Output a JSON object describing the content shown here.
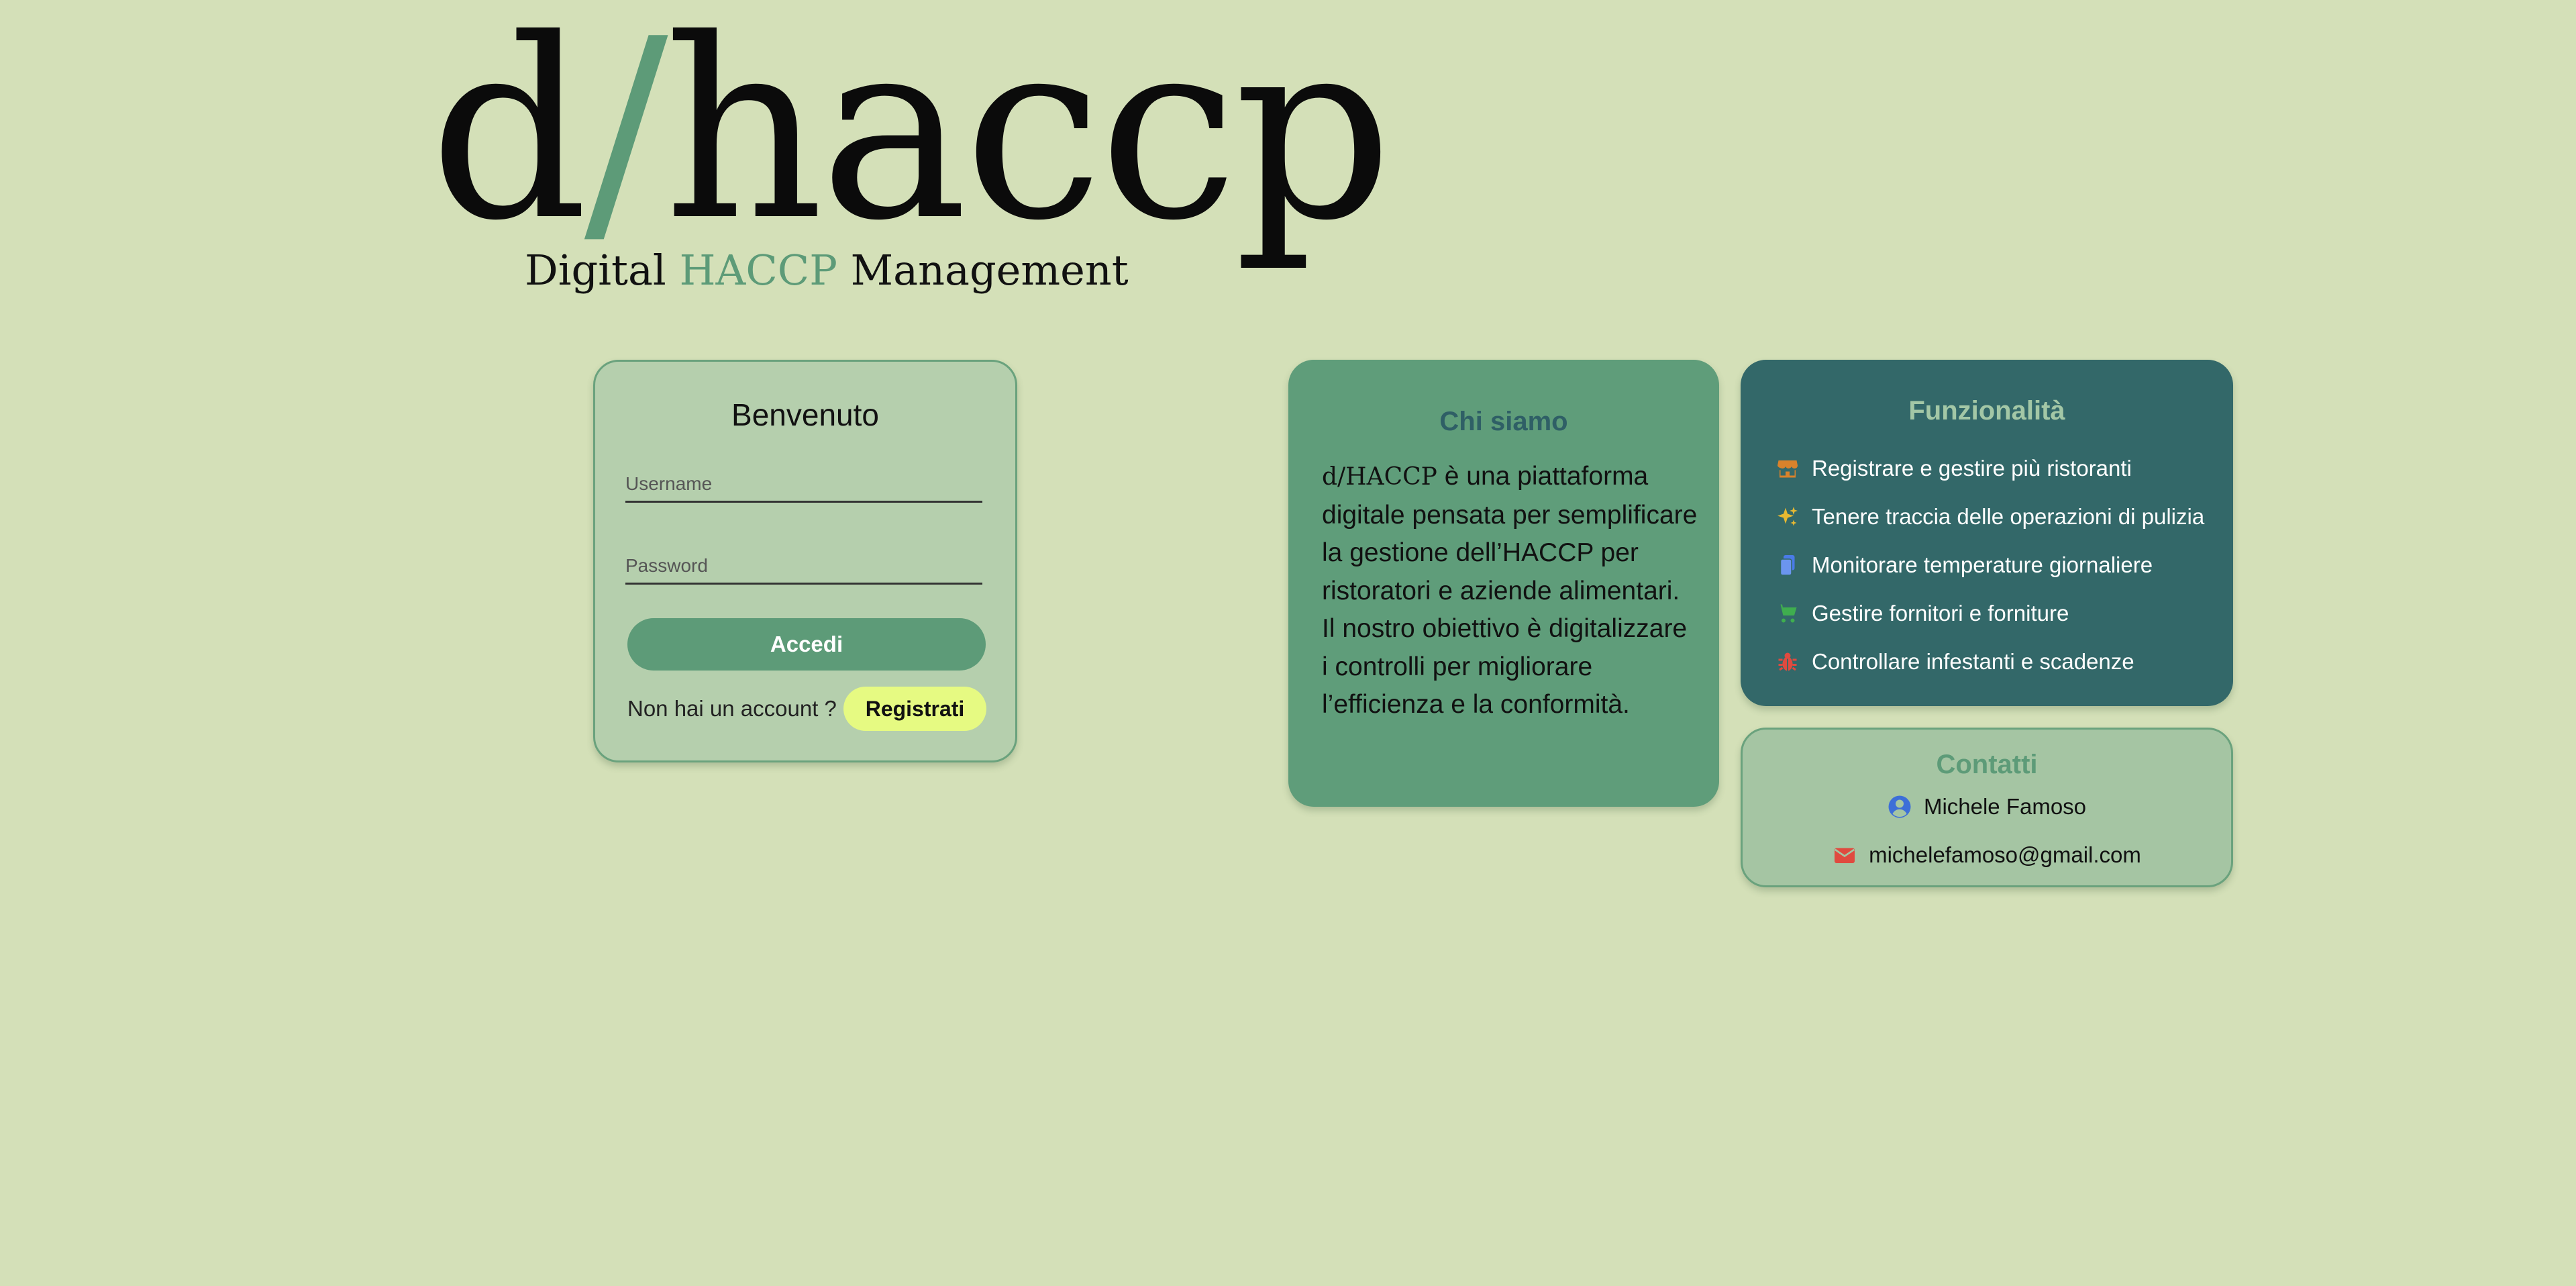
{
  "logo": {
    "prefix": "d",
    "slash": "/",
    "suffix": "haccp"
  },
  "tagline": {
    "part1": "Digital",
    "accent": "HACCP",
    "part2": "Management"
  },
  "login": {
    "title": "Benvenuto",
    "username_placeholder": "Username",
    "password_placeholder": "Password",
    "submit_label": "Accedi",
    "no_account_text": "Non hai un account ?",
    "register_label": "Registrati"
  },
  "about": {
    "title": "Chi siamo",
    "brand": "d/HACCP",
    "text": " è una piattaforma digitale pensata per semplificare la gestione dell’HACCP per ristoratori e aziende alimentari. Il nostro obiettivo è digitalizzare i controlli per migliorare l’efficienza e la conformità."
  },
  "features": {
    "title": "Funzionalità",
    "items": [
      {
        "icon": "store-icon",
        "color": "#d9822b",
        "label": "Registrare e gestire più ristoranti"
      },
      {
        "icon": "sparkles-icon",
        "color": "#e8b931",
        "label": "Tenere traccia delle operazioni di pulizia"
      },
      {
        "icon": "clipboard-icon",
        "color": "#4a7be8",
        "label": "Monitorare temperature giornaliere"
      },
      {
        "icon": "cart-icon",
        "color": "#3fae4f",
        "label": "Gestire fornitori e forniture"
      },
      {
        "icon": "bug-icon",
        "color": "#e04a3f",
        "label": "Controllare infestanti e scadenze"
      }
    ]
  },
  "contacts": {
    "title": "Contatti",
    "name": "Michele Famoso",
    "email": "michelefamoso@gmail.com"
  },
  "colors": {
    "background": "#d4e0b8",
    "accent": "#5d9b78",
    "dark_teal": "#336869",
    "register_yellow": "#e6fa82"
  }
}
